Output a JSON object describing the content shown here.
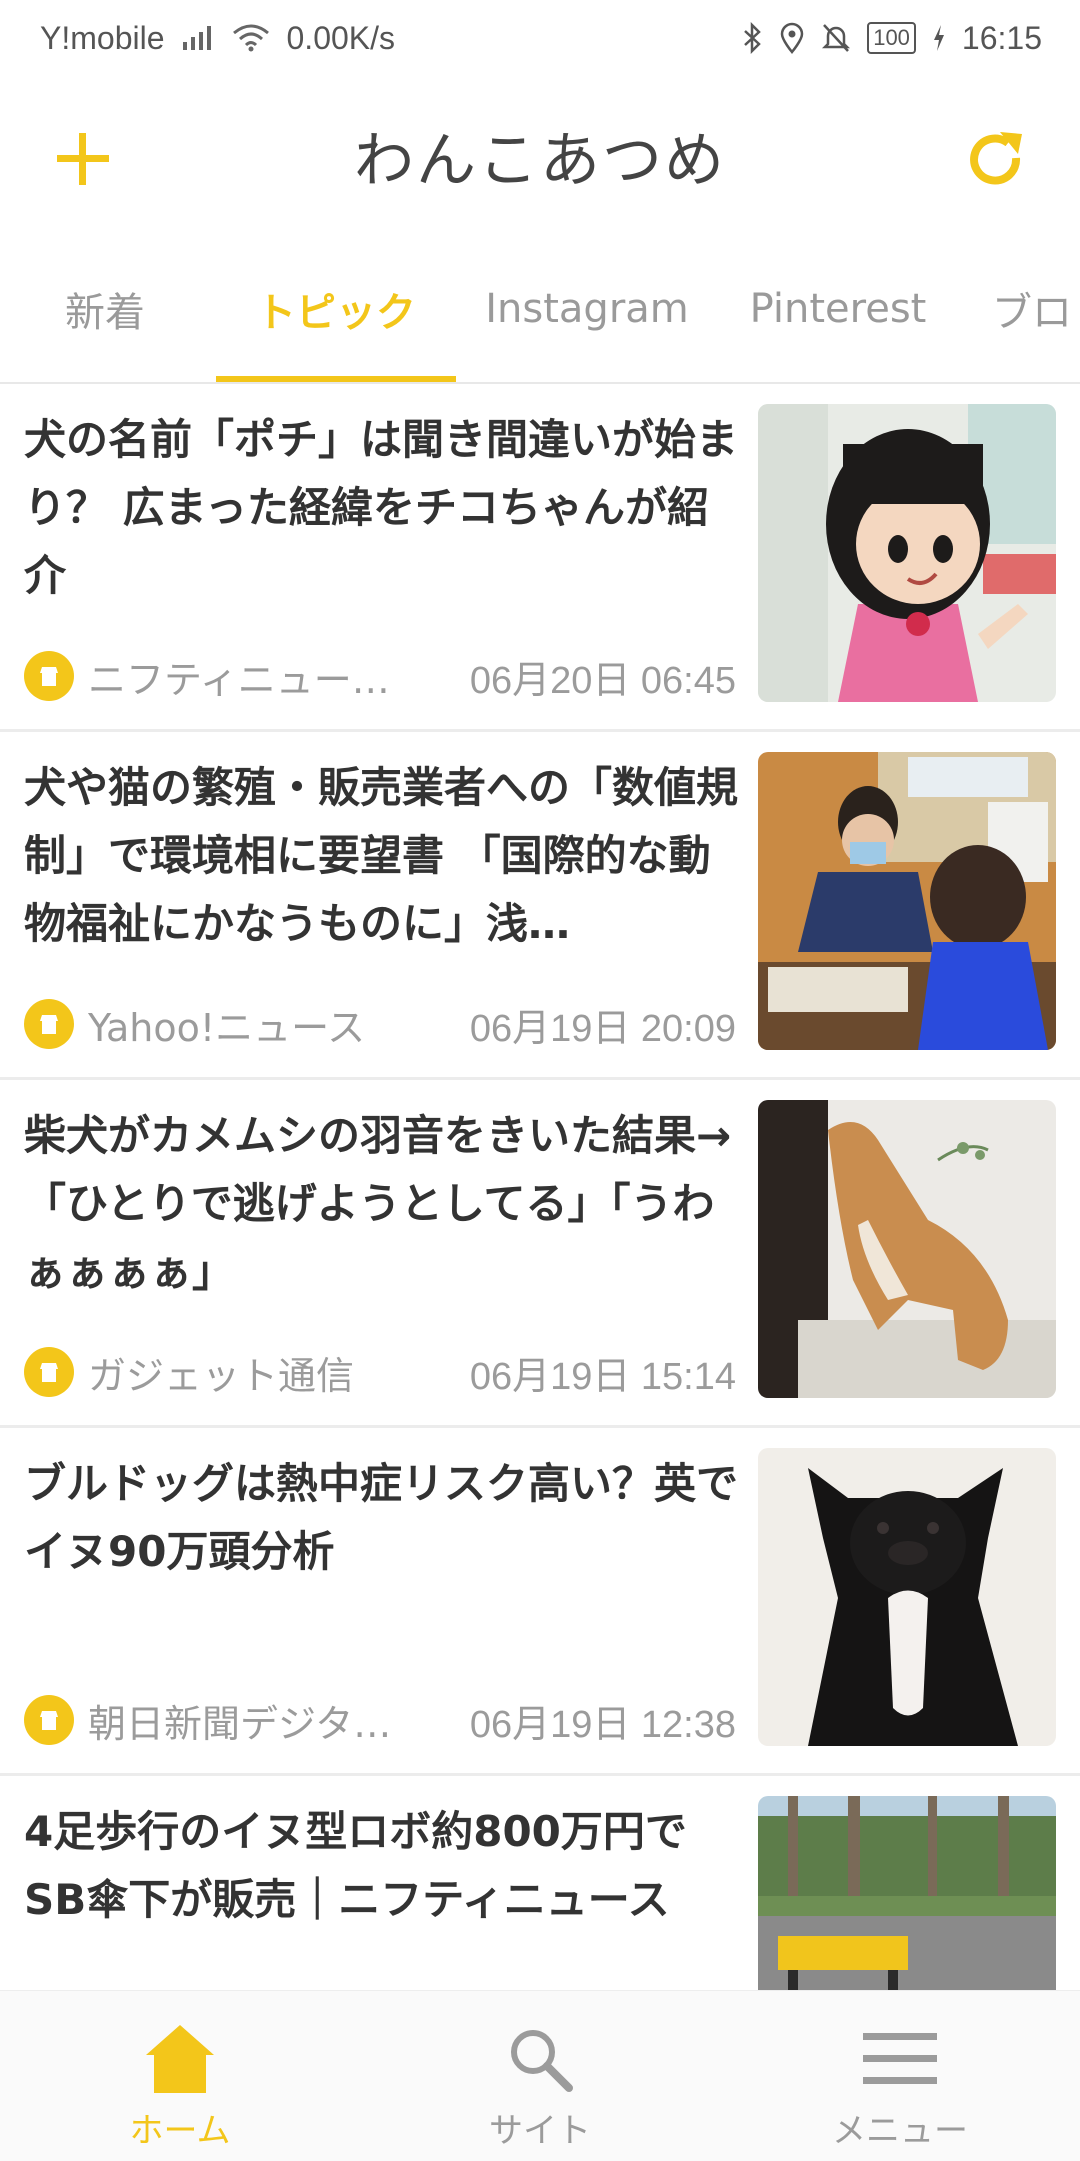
{
  "status_bar": {
    "carrier": "Y!mobile",
    "speed": "0.00K/s",
    "battery": "100",
    "time": "16:15",
    "icons": [
      "signal-icon",
      "wifi-icon",
      "bluetooth-icon",
      "location-icon",
      "mute-icon",
      "battery-icon",
      "charging-icon"
    ]
  },
  "app_bar": {
    "title": "わんこあつめ",
    "accent_color": "#f3c61a",
    "left_icon": "plus-icon",
    "right_icon": "refresh-icon"
  },
  "tabs": [
    {
      "label": "新着",
      "active": false
    },
    {
      "label": "トピック",
      "active": true
    },
    {
      "label": "Instagram",
      "active": false
    },
    {
      "label": "Pinterest",
      "active": false
    },
    {
      "label": "ブロ",
      "active": false
    }
  ],
  "articles": [
    {
      "title": "犬の名前「ポチ」は聞き間違いが始まり？ 広まった経緯をチコちゃんが紹介",
      "source": "ニフティニュー…",
      "date": "06月20日 06:45",
      "thumbnail": "character-doll-photo"
    },
    {
      "title": "犬や猫の繁殖・販売業者への「数値規制」で環境相に要望書 「国際的な動物福祉にかなうものに」浅…",
      "source": "Yahoo!ニュース",
      "date": "06月19日 20:09",
      "thumbnail": "meeting-photo"
    },
    {
      "title": "柴犬がカメムシの羽音をきいた結果→「ひとりで逃げようとしてる」「うわぁぁぁぁ」",
      "source": "ガジェット通信",
      "date": "06月19日 15:14",
      "thumbnail": "shiba-dog-photo"
    },
    {
      "title": "ブルドッグは熱中症リスク高い？英でイヌ90万頭分析",
      "source": "朝日新聞デジタ…",
      "date": "06月19日 12:38",
      "thumbnail": "black-bulldog-photo"
    },
    {
      "title": "4足歩行のイヌ型ロボ約800万円でSB傘下が販売｜ニフティニュース",
      "source": "",
      "date": "",
      "thumbnail": "robot-dog-photo"
    }
  ],
  "bottom_nav": [
    {
      "label": "ホーム",
      "icon": "home-icon",
      "active": true
    },
    {
      "label": "サイト",
      "icon": "search-icon",
      "active": false
    },
    {
      "label": "メニュー",
      "icon": "menu-icon",
      "active": false
    }
  ]
}
